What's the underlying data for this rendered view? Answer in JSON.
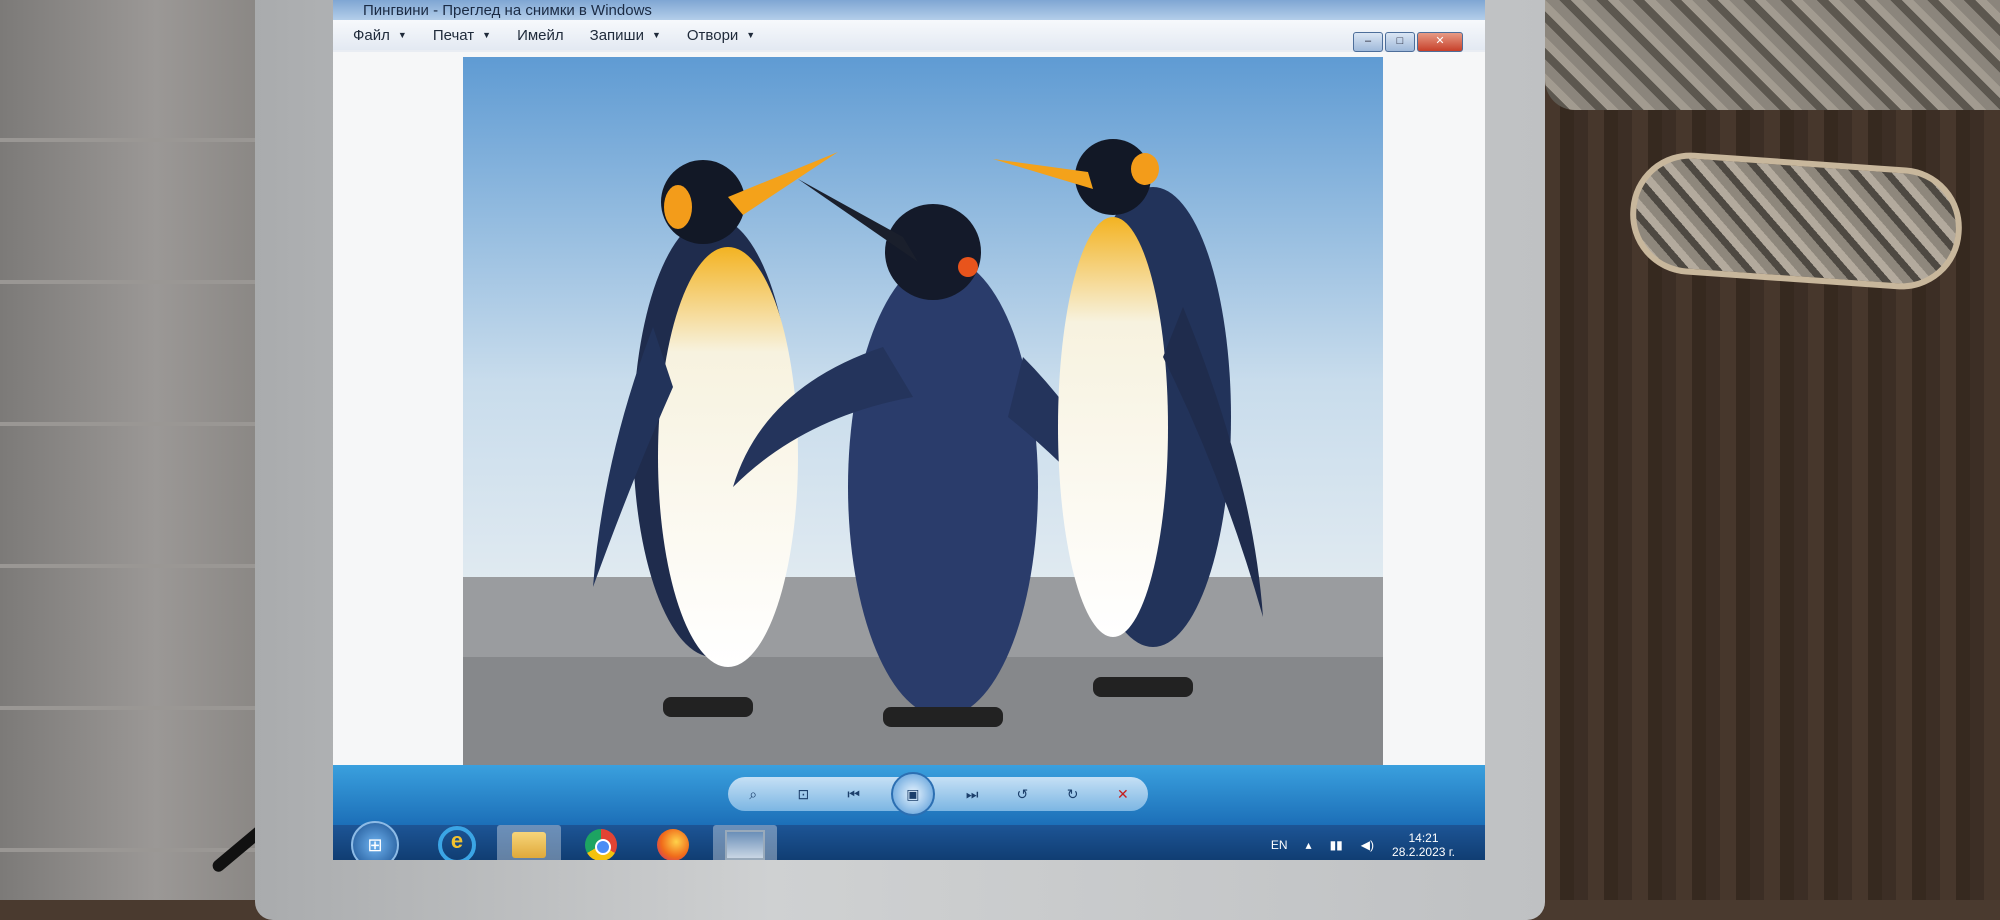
{
  "window": {
    "title": "Пингвини - Преглед на снимки в Windows",
    "minimize_glyph": "–",
    "maximize_glyph": "□",
    "close_glyph": "✕",
    "help_glyph": "?"
  },
  "menu": {
    "items": [
      {
        "label": "Файл",
        "has_arrow": true
      },
      {
        "label": "Печат",
        "has_arrow": true
      },
      {
        "label": "Имейл",
        "has_arrow": false
      },
      {
        "label": "Запиши",
        "has_arrow": true
      },
      {
        "label": "Отвори",
        "has_arrow": true
      }
    ],
    "arrow_glyph": "▼"
  },
  "photo": {
    "subject": "king-penguins-icon",
    "colors": {
      "sky_top": "#5f9bd3",
      "sky_bottom": "#d9e7f1",
      "ground": "#9a9c9f",
      "beak": "#f4a21a",
      "body_dark": "#24345c"
    }
  },
  "viewer_toolbar": {
    "zoom_glyph": "⌕",
    "fit_glyph": "⊡",
    "prev_glyph": "⏮",
    "play_glyph": "▣",
    "next_glyph": "⏭",
    "rotate_left_glyph": "↺",
    "rotate_right_glyph": "↻",
    "delete_glyph": "✕"
  },
  "taskbar": {
    "start_glyph": "⊞",
    "apps": [
      "internet-explorer",
      "file-explorer",
      "chrome",
      "firefox",
      "photo-viewer"
    ],
    "ie_glyph": "e",
    "tray": {
      "language": "EN",
      "time": "14:21",
      "date": "28.2.2023 г."
    }
  }
}
